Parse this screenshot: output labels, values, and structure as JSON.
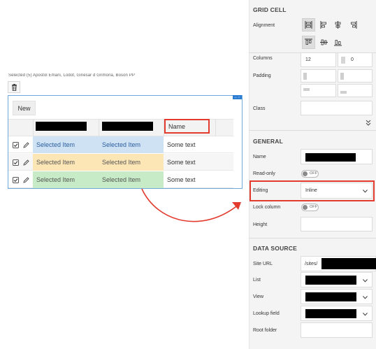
{
  "canvas": {
    "breadcrumb": "Selected (5) Apostol Emani, Lodot, Ginesar d Grimona, Boson PP",
    "new_button": "New",
    "header_name": "Name",
    "resize_glyph": "↔⇔",
    "rows": [
      {
        "col1": "Selected Item",
        "col2": "Selected Item",
        "col3": "Some text",
        "color": "#cfe2f3",
        "text_color": "#2a5d9f"
      },
      {
        "col1": "Selected Item",
        "col2": "Selected Item",
        "col3": "Some text",
        "color": "#fde6b6",
        "text_color": "#555555"
      },
      {
        "col1": "Selected Item",
        "col2": "Selected Item",
        "col3": "Some text",
        "color": "#c6ebc6",
        "text_color": "#555555"
      }
    ]
  },
  "panel": {
    "grid_cell": {
      "title": "GRID CELL",
      "alignment_label": "Alignment",
      "columns_label": "Columns",
      "columns_value": "12",
      "columns_offset": "0",
      "padding_label": "Padding",
      "class_label": "Class",
      "collapse_icon": "double-chevron-down-icon"
    },
    "general": {
      "title": "GENERAL",
      "name_label": "Name",
      "readonly_label": "Read-only",
      "readonly_state": "OFF",
      "editing_label": "Editing",
      "editing_value": "Inline",
      "lock_label": "Lock column",
      "lock_state": "OFF",
      "height_label": "Height"
    },
    "data_source": {
      "title": "DATA SOURCE",
      "site_url_label": "Site URL",
      "site_url_value": "/sites/",
      "list_label": "List",
      "view_label": "View",
      "lookup_label": "Lookup field",
      "root_label": "Root folder"
    }
  },
  "colors": {
    "highlight_red": "#e33b2e",
    "selection_blue": "#6fa8dc",
    "panel_bg": "#f4f4f4"
  }
}
